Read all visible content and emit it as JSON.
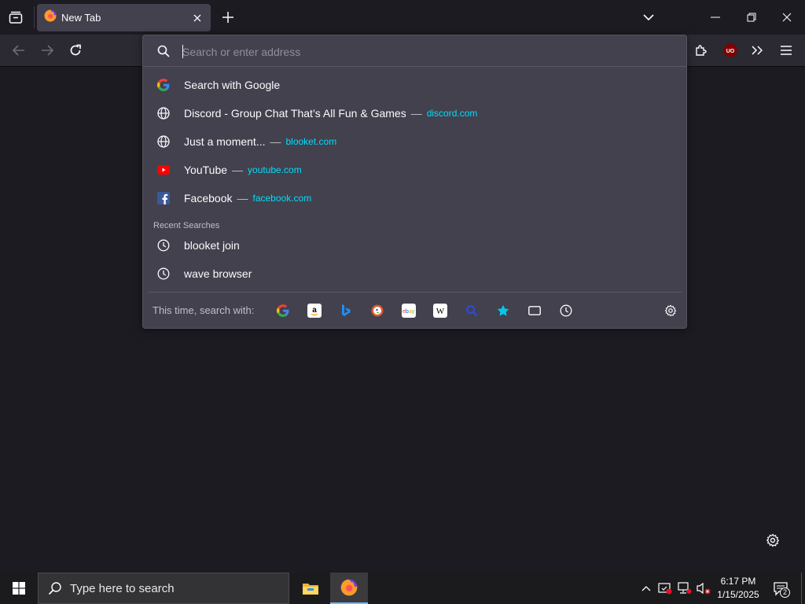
{
  "browser": {
    "tab": {
      "title": "New Tab"
    },
    "urlbar": {
      "placeholder": "Search or enter address",
      "suggestions": [
        {
          "icon": "google-icon",
          "title": "Search with Google",
          "url": ""
        },
        {
          "icon": "globe-icon",
          "title": "Discord - Group Chat That’s All Fun & Games",
          "url": "discord.com"
        },
        {
          "icon": "globe-icon",
          "title": "Just a moment...",
          "url": "blooket.com"
        },
        {
          "icon": "youtube-icon",
          "title": "YouTube",
          "url": "youtube.com"
        },
        {
          "icon": "facebook-icon",
          "title": "Facebook",
          "url": "facebook.com"
        }
      ],
      "separator": "—",
      "recent_label": "Recent Searches",
      "recent": [
        {
          "icon": "history-icon",
          "title": "blooket join"
        },
        {
          "icon": "history-icon",
          "title": "wave browser"
        }
      ],
      "oneoff_label": "This time, search with:",
      "engines": [
        "google-icon",
        "amazon-icon",
        "bing-icon",
        "duckduckgo-icon",
        "ebay-icon",
        "wikipedia-icon",
        "search-icon",
        "bookmarks-icon",
        "tabs-icon",
        "history-icon"
      ]
    },
    "colors": {
      "accent_link": "#00ddff",
      "panel": "#42414d",
      "background": "#1c1b22"
    }
  },
  "taskbar": {
    "search_placeholder": "Type here to search",
    "time": "6:17 PM",
    "date": "1/15/2025",
    "notifications": "2"
  }
}
